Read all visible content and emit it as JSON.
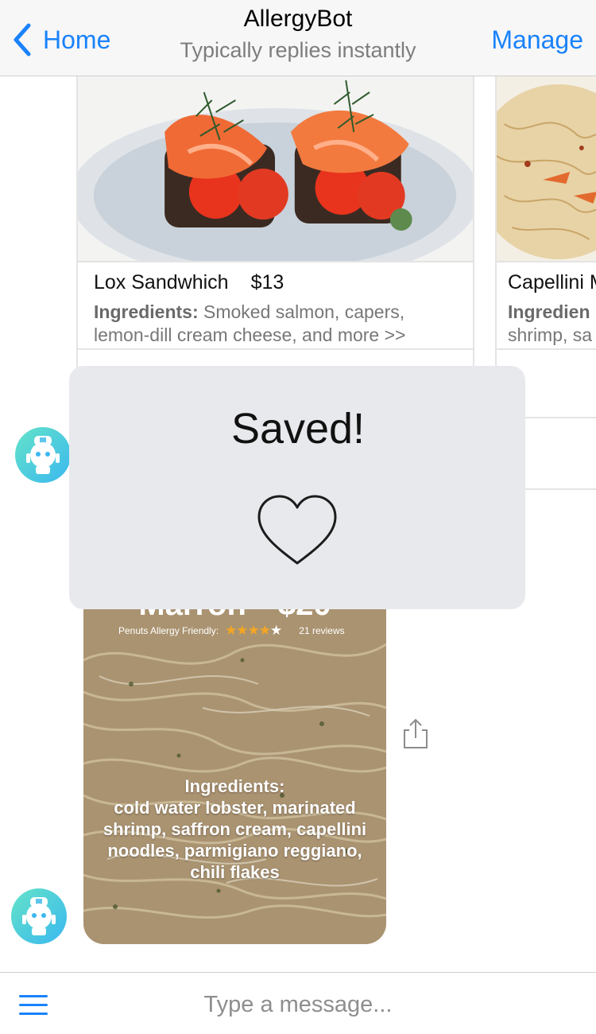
{
  "header": {
    "back_label": "Home",
    "title": "AllergyBot",
    "subtitle": "Typically replies instantly",
    "manage_label": "Manage"
  },
  "carousel": {
    "cards": [
      {
        "name": "Lox Sandwhich",
        "price": "$13",
        "ingredients_label": "Ingredients:",
        "ingredients": "Smoked salmon, capers,",
        "ingredients_line2": "lemon-dill cream cheese, and more >>"
      },
      {
        "name": "Capellini M",
        "ingredients_label": "Ingredien",
        "ingredients_line2": "shrimp, sa"
      }
    ]
  },
  "lobster_card": {
    "name": "Marron",
    "price": "$20",
    "badge": "Penuts Allergy Friendly:",
    "rating": 4,
    "rating_max": 5,
    "stars_on": "★★★★",
    "stars_off": "★",
    "reviews": "21 reviews",
    "ingredients_label": "Ingredients:",
    "ingredients": "cold water lobster, marinated shrimp, saffron cream, capellini noodles, parmigiano reggiano, chili flakes"
  },
  "toast": {
    "text": "Saved!",
    "icon": "heart-outline-icon"
  },
  "composer": {
    "placeholder": "Type a message..."
  },
  "colors": {
    "accent": "#1a82fb",
    "toast_bg": "#e8e9ed",
    "star": "#f5a623"
  }
}
